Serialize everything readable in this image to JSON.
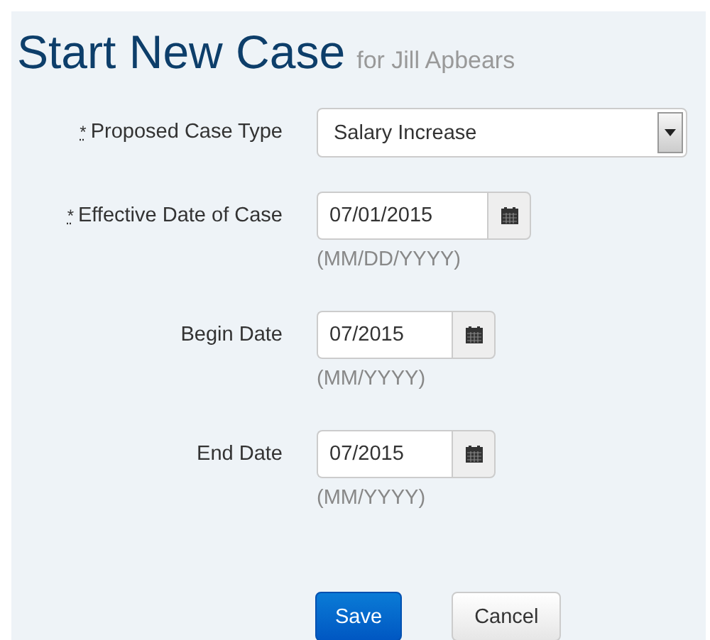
{
  "title": "Start New Case",
  "subtitle": "for Jill Apbears",
  "fields": [
    {
      "kind": "select",
      "marker": "*",
      "label": "Proposed Case Type",
      "value": "Salary Increase"
    },
    {
      "kind": "date",
      "marker": "*",
      "label": "Effective Date of Case",
      "value": "07/01/2015",
      "hint": "(MM/DD/YYYY)"
    },
    {
      "kind": "date",
      "label": "Begin Date",
      "value": "07/2015",
      "hint": "(MM/YYYY)"
    },
    {
      "kind": "date",
      "label": "End Date",
      "value": "07/2015",
      "hint": "(MM/YYYY)"
    }
  ],
  "buttons": [
    {
      "kind": "primary",
      "label": "Save"
    },
    {
      "kind": "default",
      "label": "Cancel"
    }
  ]
}
